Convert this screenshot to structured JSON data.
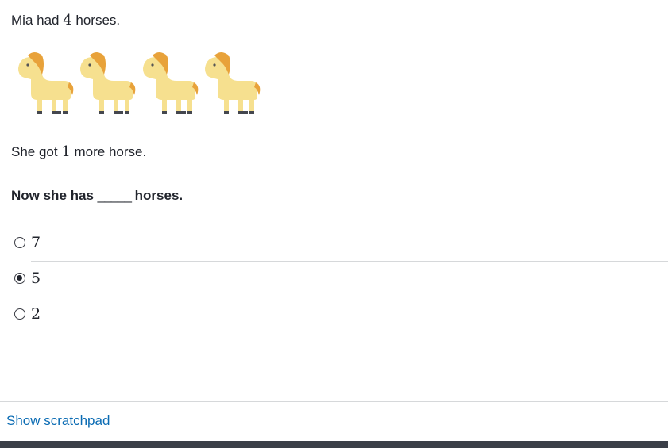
{
  "problem": {
    "line1": {
      "pre": "Mia had ",
      "num": "4",
      "post": " horses."
    },
    "horse_count": 4,
    "horse_icon": "horse-icon",
    "line2": {
      "pre": "She got ",
      "num": "1",
      "post": " more horse."
    },
    "line3": {
      "pre": "Now she has ",
      "blank": "_____",
      "post": " horses."
    }
  },
  "choices": [
    {
      "label": "7",
      "selected": false
    },
    {
      "label": "5",
      "selected": true
    },
    {
      "label": "2",
      "selected": false
    }
  ],
  "footer": {
    "scratchpad_label": "Show scratchpad"
  },
  "colors": {
    "link": "#0a6bb3",
    "bottom_bar": "#3b3f48",
    "horse_body": "#f6e08f",
    "horse_mane": "#e8a23a"
  }
}
